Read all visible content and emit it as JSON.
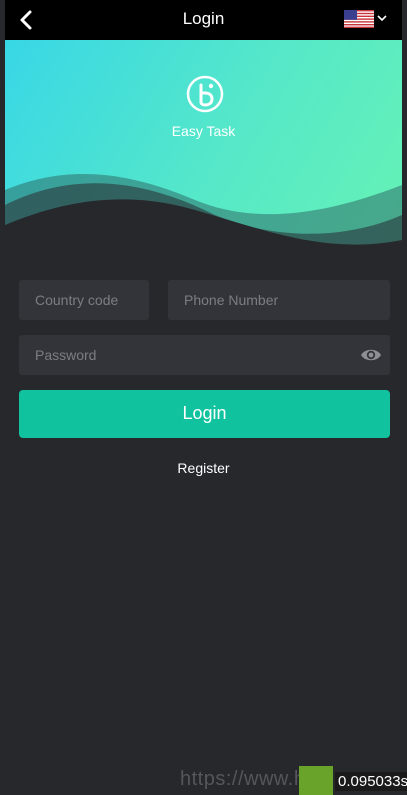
{
  "navbar": {
    "title": "Login",
    "back_icon": "chevron-left-icon",
    "language_flag": "us-flag-icon",
    "language_chevron": "chevron-down-icon"
  },
  "hero": {
    "app_name": "Easy Task",
    "logo_icon": "easy-task-logo-icon",
    "colors": {
      "gradient_start": "#38d7e6",
      "gradient_end": "#66f2b4"
    }
  },
  "form": {
    "country_code_placeholder": "Country code",
    "phone_placeholder": "Phone Number",
    "password_placeholder": "Password",
    "password_visibility_icon": "eye-icon",
    "login_label": "Login",
    "register_label": "Register"
  },
  "overlay": {
    "watermark_text": "https://www.hu",
    "timer_text": "0.095033s"
  },
  "colors": {
    "background": "#27282c",
    "field_background": "#333439",
    "accent": "#10c39e",
    "navbar": "#000000"
  }
}
